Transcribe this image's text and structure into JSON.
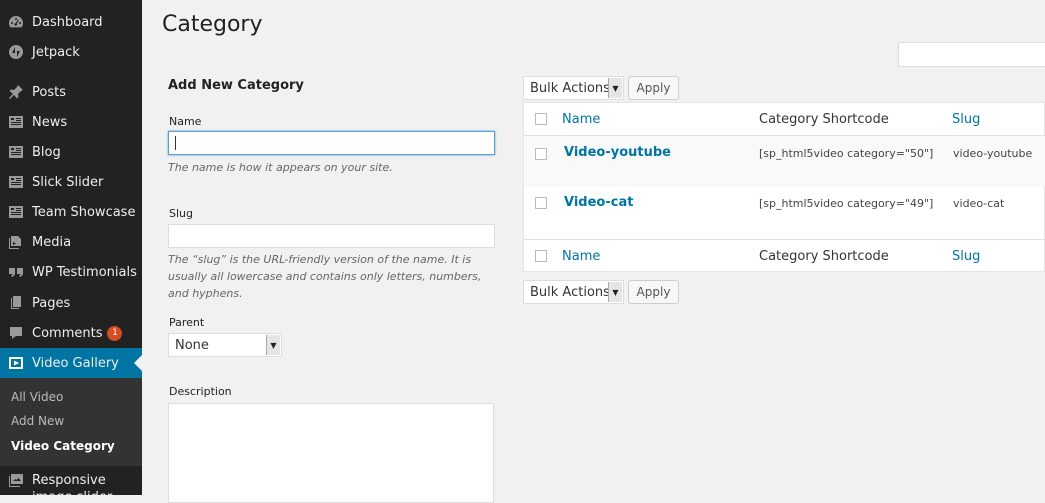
{
  "sidebar": {
    "items": [
      {
        "label": "Dashboard",
        "icon": "dashboard-icon"
      },
      {
        "label": "Jetpack",
        "icon": "jetpack-icon"
      },
      {
        "label": "Posts",
        "icon": "pin-icon"
      },
      {
        "label": "News",
        "icon": "list-icon"
      },
      {
        "label": "Blog",
        "icon": "list-icon"
      },
      {
        "label": "Slick Slider",
        "icon": "list-icon"
      },
      {
        "label": "Team Showcase",
        "icon": "list-icon"
      },
      {
        "label": "Media",
        "icon": "media-icon"
      },
      {
        "label": "WP Testimonials",
        "icon": "quote-icon"
      },
      {
        "label": "Pages",
        "icon": "pages-icon"
      },
      {
        "label": "Comments",
        "icon": "comment-icon",
        "badge": "1"
      },
      {
        "label": "Video Gallery",
        "icon": "video-icon"
      },
      {
        "label": "Responsive image slider",
        "icon": "images-icon"
      }
    ],
    "submenu": [
      "All Video",
      "Add New",
      "Video Category"
    ],
    "accent_color": "#0074a2"
  },
  "page": {
    "title": "Category"
  },
  "form": {
    "heading": "Add New Category",
    "name_label": "Name",
    "name_value": "",
    "name_hint": "The name is how it appears on your site.",
    "slug_label": "Slug",
    "slug_value": "",
    "slug_hint": "The “slug” is the URL-friendly version of the name. It is usually all lowercase and contains only letters, numbers, and hyphens.",
    "parent_label": "Parent",
    "parent_value": "None",
    "description_label": "Description"
  },
  "bulk": {
    "label": "Bulk Actions",
    "apply": "Apply"
  },
  "table": {
    "columns": {
      "name": "Name",
      "shortcode": "Category Shortcode",
      "slug": "Slug"
    },
    "rows": [
      {
        "name": "Video-youtube",
        "shortcode": "[sp_html5video category=\"50\"]",
        "slug": "video-youtube"
      },
      {
        "name": "Video-cat",
        "shortcode": "[sp_html5video category=\"49\"]",
        "slug": "video-cat"
      }
    ]
  }
}
